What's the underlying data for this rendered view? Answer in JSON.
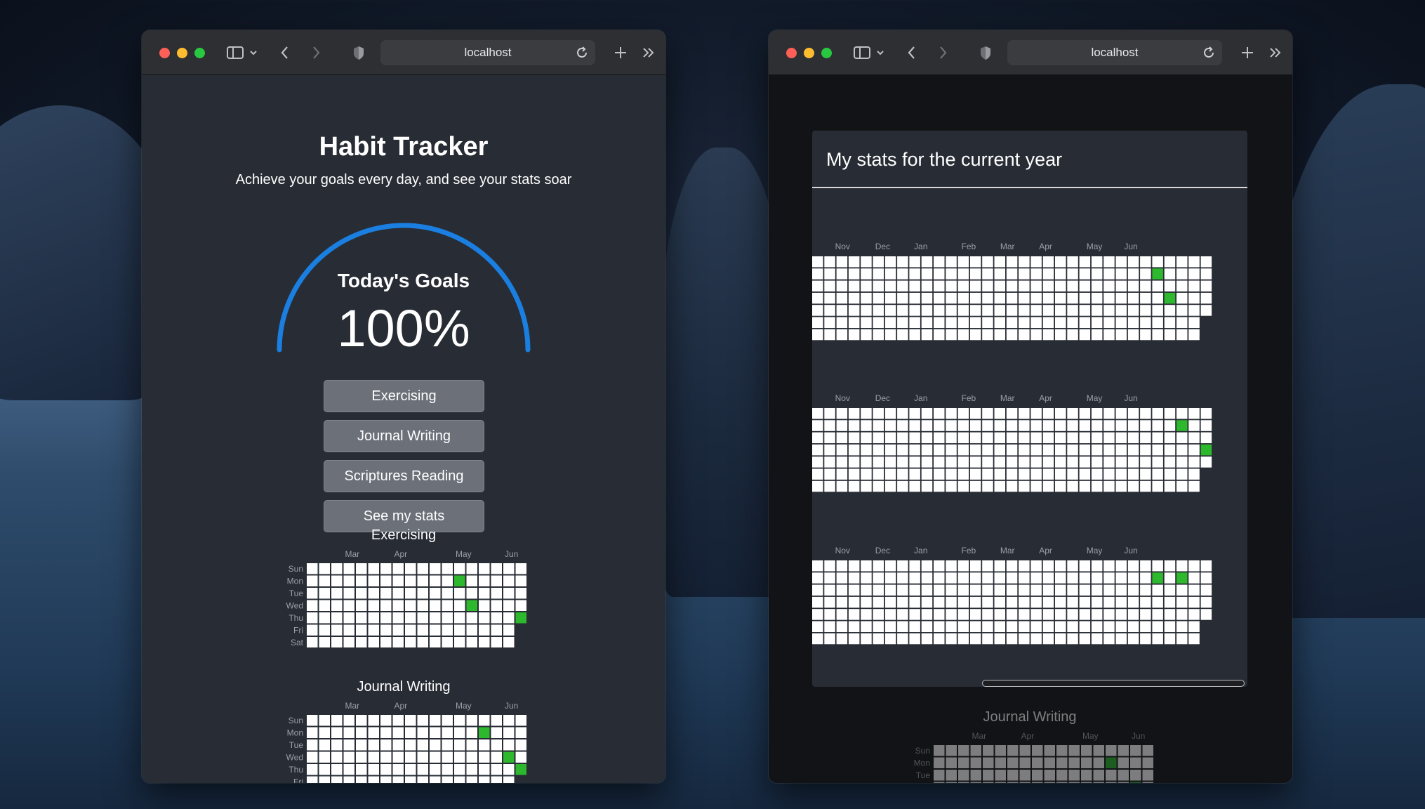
{
  "left_window": {
    "url": "localhost",
    "app": {
      "title": "Habit Tracker",
      "subtitle": "Achieve your goals every day, and see your stats soar"
    },
    "gauge": {
      "label": "Today's Goals",
      "value_text": "100%",
      "progress": 1.0,
      "color": "#1a7fe0"
    },
    "buttons": [
      "Exercising",
      "Journal Writing",
      "Scriptures Reading",
      "See my stats"
    ],
    "habits": [
      {
        "name": "Exercising",
        "months": [
          "Mar",
          "Apr",
          "May",
          "Jun"
        ],
        "days": [
          "Sun",
          "Mon",
          "Tue",
          "Wed",
          "Thu",
          "Fri",
          "Sat"
        ],
        "cols": 18,
        "last_col_days": 5,
        "done": [
          [
            12,
            1
          ],
          [
            13,
            3
          ],
          [
            17,
            4
          ]
        ]
      },
      {
        "name": "Journal Writing",
        "months": [
          "Mar",
          "Apr",
          "May",
          "Jun"
        ],
        "days": [
          "Sun",
          "Mon",
          "Tue",
          "Wed",
          "Thu",
          "Fri",
          "Sat"
        ],
        "cols": 18,
        "last_col_days": 5,
        "done": [
          [
            14,
            1
          ],
          [
            16,
            3
          ],
          [
            17,
            4
          ]
        ]
      }
    ]
  },
  "right_window": {
    "url": "localhost",
    "modal": {
      "title": "My stats for the current year",
      "charts": [
        {
          "months": [
            "Nov",
            "Dec",
            "Jan",
            "Feb",
            "Mar",
            "Apr",
            "May",
            "Jun"
          ],
          "cols": 33,
          "last_col_days": 5,
          "done": [
            [
              28,
              1
            ],
            [
              29,
              3
            ],
            [
              33,
              4
            ]
          ]
        },
        {
          "months": [
            "Nov",
            "Dec",
            "Jan",
            "Feb",
            "Mar",
            "Apr",
            "May",
            "Jun"
          ],
          "cols": 33,
          "last_col_days": 5,
          "done": [
            [
              30,
              1
            ],
            [
              32,
              3
            ],
            [
              33,
              4
            ]
          ]
        },
        {
          "months": [
            "Nov",
            "Dec",
            "Jan",
            "Feb",
            "Mar",
            "Apr",
            "May",
            "Jun"
          ],
          "cols": 33,
          "last_col_days": 5,
          "done": [
            [
              28,
              1
            ],
            [
              30,
              1
            ],
            [
              33,
              4
            ]
          ]
        }
      ]
    },
    "background_section": {
      "title": "Journal Writing",
      "months": [
        "Mar",
        "Apr",
        "May",
        "Jun"
      ],
      "days": [
        "Sun",
        "Mon",
        "Tue",
        "Wed",
        "Thu",
        "Fri",
        "Sat"
      ],
      "cols": 18,
      "last_col_days": 5,
      "done": [
        [
          14,
          1
        ],
        [
          16,
          3
        ],
        [
          17,
          4
        ]
      ]
    }
  },
  "colors": {
    "done": "#2eb82e",
    "empty": "#ffffff",
    "app_bg": "#282c34"
  }
}
